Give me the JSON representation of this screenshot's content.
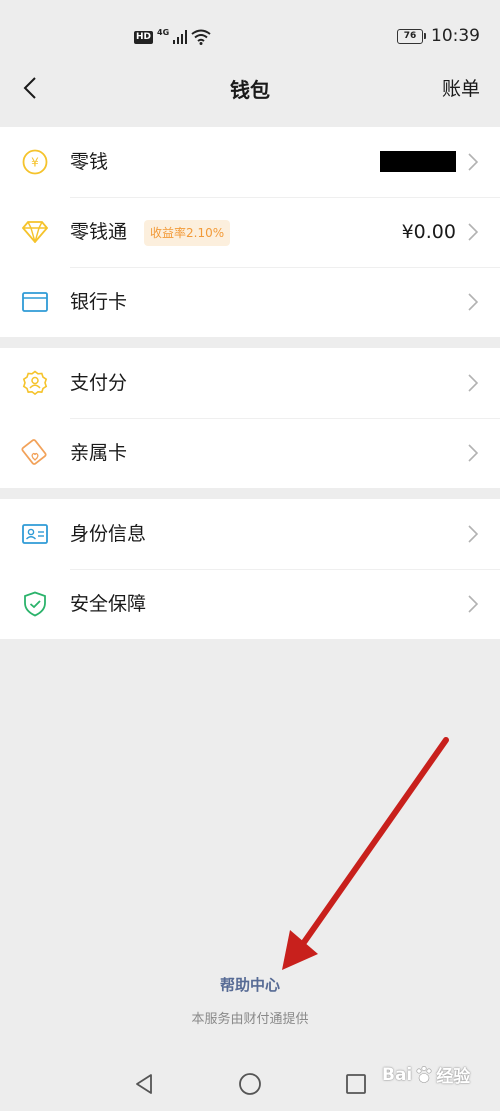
{
  "status_bar": {
    "hd": "HD",
    "network": "4G",
    "battery": "76",
    "time": "10:39"
  },
  "nav": {
    "title": "钱包",
    "right": "账单"
  },
  "groups": [
    [
      {
        "label": "零钱",
        "value_masked": true
      },
      {
        "label": "零钱通",
        "tag": "收益率2.10%",
        "value": "¥0.00"
      },
      {
        "label": "银行卡"
      }
    ],
    [
      {
        "label": "支付分"
      },
      {
        "label": "亲属卡"
      }
    ],
    [
      {
        "label": "身份信息"
      },
      {
        "label": "安全保障"
      }
    ]
  ],
  "footer": {
    "help": "帮助中心",
    "provider": "本服务由财付通提供"
  },
  "watermark": {
    "brand": "Bai",
    "cn": "经验"
  },
  "colors": {
    "yellow": "#f5c32c",
    "blue": "#2f9bd6",
    "green": "#2bb36b",
    "orange": "#f2a25a",
    "link": "#576b95",
    "annotation_arrow": "#c8201c"
  }
}
